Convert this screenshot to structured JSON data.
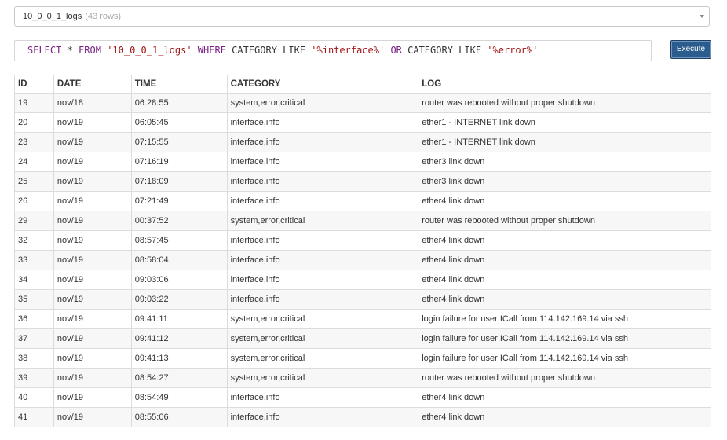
{
  "table_select": {
    "name": "10_0_0_1_logs",
    "rows_label": "(43 rows)"
  },
  "query": {
    "tokens": [
      {
        "t": "SELECT",
        "c": "kw"
      },
      {
        "t": " * ",
        "c": "idt"
      },
      {
        "t": "FROM",
        "c": "kw"
      },
      {
        "t": " ",
        "c": "idt"
      },
      {
        "t": "'10_0_0_1_logs'",
        "c": "str"
      },
      {
        "t": " ",
        "c": "idt"
      },
      {
        "t": "WHERE",
        "c": "kw"
      },
      {
        "t": " CATEGORY LIKE ",
        "c": "idt"
      },
      {
        "t": "'%interface%'",
        "c": "str"
      },
      {
        "t": " ",
        "c": "idt"
      },
      {
        "t": "OR",
        "c": "kw"
      },
      {
        "t": " CATEGORY LIKE ",
        "c": "idt"
      },
      {
        "t": "'%error%'",
        "c": "str"
      }
    ]
  },
  "execute_label": "Execute",
  "results": {
    "columns": [
      "ID",
      "DATE",
      "TIME",
      "CATEGORY",
      "LOG"
    ],
    "rows": [
      [
        "19",
        "nov/18",
        "06:28:55",
        "system,error,critical",
        "router was rebooted without proper shutdown"
      ],
      [
        "20",
        "nov/19",
        "06:05:45",
        "interface,info",
        "ether1 - INTERNET link down"
      ],
      [
        "23",
        "nov/19",
        "07:15:55",
        "interface,info",
        "ether1 - INTERNET link down"
      ],
      [
        "24",
        "nov/19",
        "07:16:19",
        "interface,info",
        "ether3 link down"
      ],
      [
        "25",
        "nov/19",
        "07:18:09",
        "interface,info",
        "ether3 link down"
      ],
      [
        "26",
        "nov/19",
        "07:21:49",
        "interface,info",
        "ether4 link down"
      ],
      [
        "29",
        "nov/19",
        "00:37:52",
        "system,error,critical",
        "router was rebooted without proper shutdown"
      ],
      [
        "32",
        "nov/19",
        "08:57:45",
        "interface,info",
        "ether4 link down"
      ],
      [
        "33",
        "nov/19",
        "08:58:04",
        "interface,info",
        "ether4 link down"
      ],
      [
        "34",
        "nov/19",
        "09:03:06",
        "interface,info",
        "ether4 link down"
      ],
      [
        "35",
        "nov/19",
        "09:03:22",
        "interface,info",
        "ether4 link down"
      ],
      [
        "36",
        "nov/19",
        "09:41:11",
        "system,error,critical",
        "login failure for user ICall from 114.142.169.14 via ssh"
      ],
      [
        "37",
        "nov/19",
        "09:41:12",
        "system,error,critical",
        "login failure for user ICall from 114.142.169.14 via ssh"
      ],
      [
        "38",
        "nov/19",
        "09:41:13",
        "system,error,critical",
        "login failure for user ICall from 114.142.169.14 via ssh"
      ],
      [
        "39",
        "nov/19",
        "08:54:27",
        "system,error,critical",
        "router was rebooted without proper shutdown"
      ],
      [
        "40",
        "nov/19",
        "08:54:49",
        "interface,info",
        "ether4 link down"
      ],
      [
        "41",
        "nov/19",
        "08:55:06",
        "interface,info",
        "ether4 link down"
      ]
    ]
  }
}
